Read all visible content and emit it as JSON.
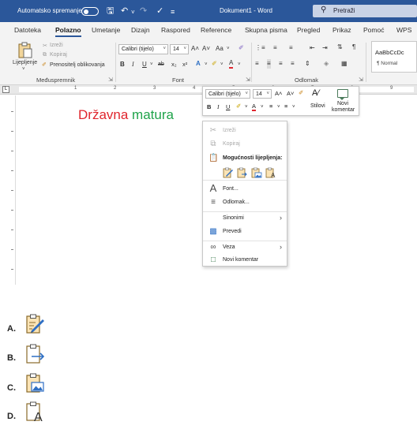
{
  "titlebar": {
    "autosave_label": "Automatsko spremanje",
    "doc_title": "Dokument1 - Word",
    "search_placeholder": "Pretraži"
  },
  "tabs": [
    "Datoteka",
    "Polazno",
    "Umetanje",
    "Dizajn",
    "Raspored",
    "Reference",
    "Skupna pisma",
    "Pregled",
    "Prikaz",
    "Pomoć",
    "WPS"
  ],
  "active_tab": "Polazno",
  "ribbon": {
    "clipboard": {
      "paste_label": "Lijepljenje",
      "cut_label": "Izreži",
      "copy_label": "Kopiraj",
      "format_painter_label": "Prenositelj oblikovanja",
      "group_label": "Međuspremnik"
    },
    "font": {
      "font_name": "Calibri (tijelo)",
      "font_size": "14",
      "grow": "A˄",
      "shrink": "A˅",
      "case": "Aa",
      "bold": "B",
      "italic": "I",
      "underline": "U",
      "strike": "ab",
      "subscript": "x₂",
      "superscript": "x²",
      "group_label": "Font"
    },
    "paragraph": {
      "group_label": "Odlomak"
    },
    "styles": {
      "preview": "AaBbCcDc",
      "normal": "¶ Normal"
    }
  },
  "ruler": {
    "numbers": [
      "1",
      "2",
      "3",
      "4",
      "5",
      "6",
      "7",
      "8",
      "9"
    ]
  },
  "document": {
    "word1": "Državna",
    "word2": "matura"
  },
  "mini_toolbar": {
    "font_name": "Calibri (tijelo)",
    "font_size": "14",
    "styles_label": "Stilovi",
    "new_comment_line1": "Novi",
    "new_comment_line2": "komentar"
  },
  "context_menu": {
    "cut": "Izreži",
    "copy": "Kopiraj",
    "paste_options": "Mogućnosti lijepljenja:",
    "font": "Font...",
    "paragraph": "Odlomak...",
    "synonyms": "Sinonimi",
    "translate": "Prevedi",
    "link": "Veza",
    "new_comment": "Novi komentar"
  },
  "answers": [
    "A.",
    "B.",
    "C.",
    "D."
  ],
  "colors": {
    "titlebar": "#2b579a",
    "word1": "#e0262e",
    "word2": "#1fa34a",
    "icon_orange": "#d68a1c",
    "icon_blue": "#2e6fc4"
  }
}
